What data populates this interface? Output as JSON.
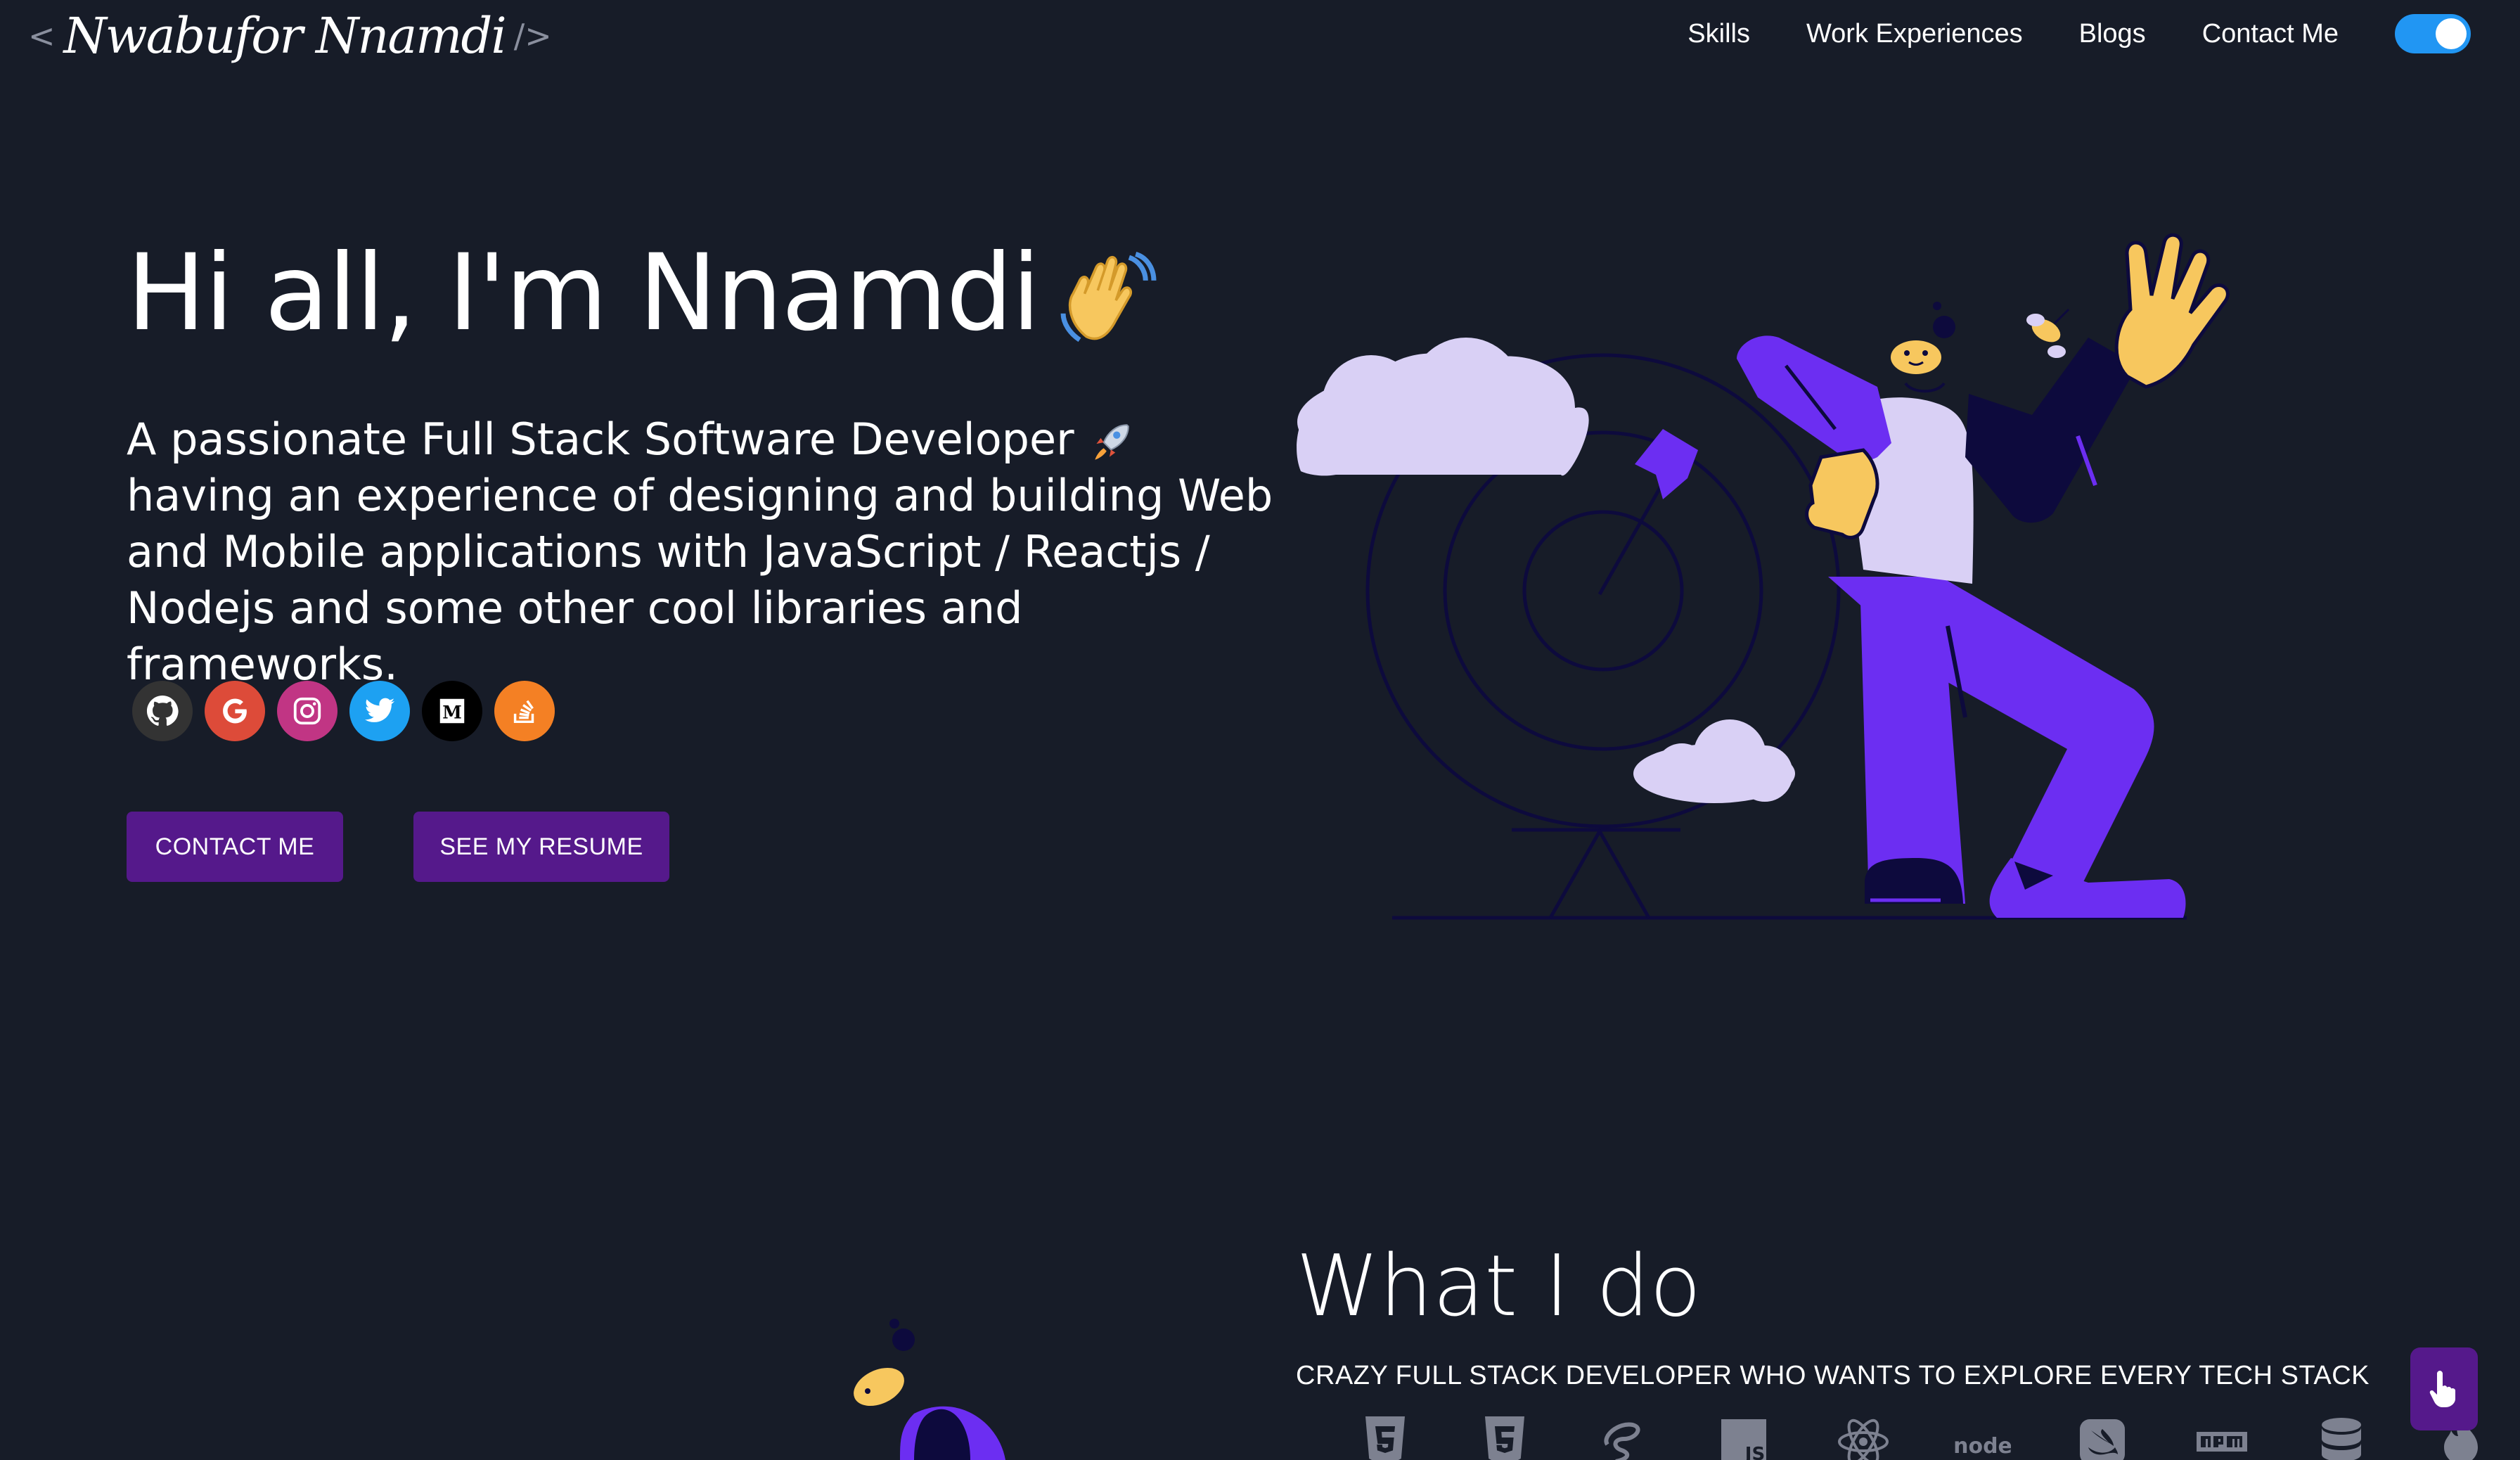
{
  "header": {
    "logo_open": "<",
    "logo_signature": "Nwabufor Nnamdi",
    "logo_close": "/>",
    "nav": [
      "Skills",
      "Work Experiences",
      "Blogs",
      "Contact Me"
    ],
    "dark_mode_toggle": "on"
  },
  "hero": {
    "greeting": "Hi all, I'm Nnamdi",
    "subtitle_before": "A passionate Full Stack Software Developer",
    "subtitle_after": "having an experience of designing and building Web and Mobile applications with JavaScript / Reactjs / Nodejs and some other cool libraries and frameworks.",
    "socials": [
      {
        "icon": "github-icon",
        "color": "#333333"
      },
      {
        "icon": "google-icon",
        "color": "#dd4b39"
      },
      {
        "icon": "instagram-icon",
        "color": "#c13584"
      },
      {
        "icon": "twitter-icon",
        "color": "#1da1f2"
      },
      {
        "icon": "medium-icon",
        "color": "#000000"
      },
      {
        "icon": "stackoverflow-icon",
        "color": "#f48024"
      }
    ],
    "contact_button": "CONTACT ME",
    "resume_button": "SEE MY RESUME"
  },
  "what_i_do": {
    "title": "What I do",
    "subtitle": "CRAZY FULL STACK DEVELOPER WHO WANTS TO EXPLORE EVERY TECH STACK",
    "tech_icons": [
      "html5-icon",
      "css3-icon",
      "sass-icon",
      "javascript-icon",
      "react-icon",
      "nodejs-icon",
      "swift-icon",
      "npm-icon",
      "database-icon",
      "fire-icon"
    ]
  },
  "colors": {
    "background": "#171c28",
    "accent": "#55198b",
    "toggle": "#2196f3",
    "illustration_purple": "#6c2ef2",
    "illustration_lavender": "#d9d0f5",
    "illustration_yellow": "#f7c75e"
  }
}
